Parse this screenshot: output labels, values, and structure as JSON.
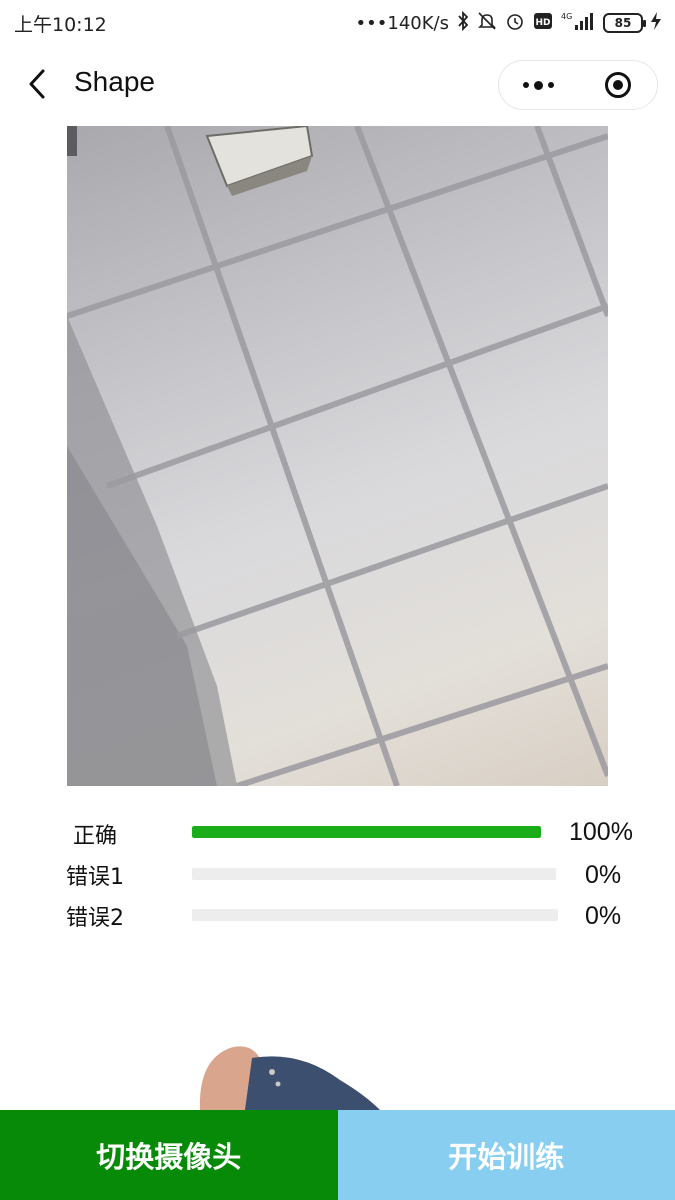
{
  "status_bar": {
    "time": "上午10:12",
    "network_speed": "•••140K/s",
    "network_type": "4G",
    "battery": "85",
    "icons": [
      "bluetooth-icon",
      "mute-icon",
      "alarm-icon",
      "hd-icon",
      "signal-icon",
      "charging-icon"
    ]
  },
  "nav": {
    "title": "Shape",
    "back_icon": "chevron-left-icon",
    "more_icon": "more-dots-icon",
    "close_icon": "target-icon"
  },
  "predictions": [
    {
      "label": "正确",
      "value": "100%",
      "fraction": 1.0,
      "color": "#1aad19"
    },
    {
      "label": "错误1",
      "value": "0%",
      "fraction": 0.0,
      "color": "#1aad19"
    },
    {
      "label": "错误2",
      "value": "0%",
      "fraction": 0.0,
      "color": "#1aad19"
    }
  ],
  "buttons": {
    "switch_camera": "切换摄像头",
    "start_training": "开始训练"
  },
  "colors": {
    "switch_button_bg": "#078a07",
    "start_button_bg": "#87cef0",
    "progress_track": "#ededed",
    "progress_fill": "#1aad19"
  }
}
